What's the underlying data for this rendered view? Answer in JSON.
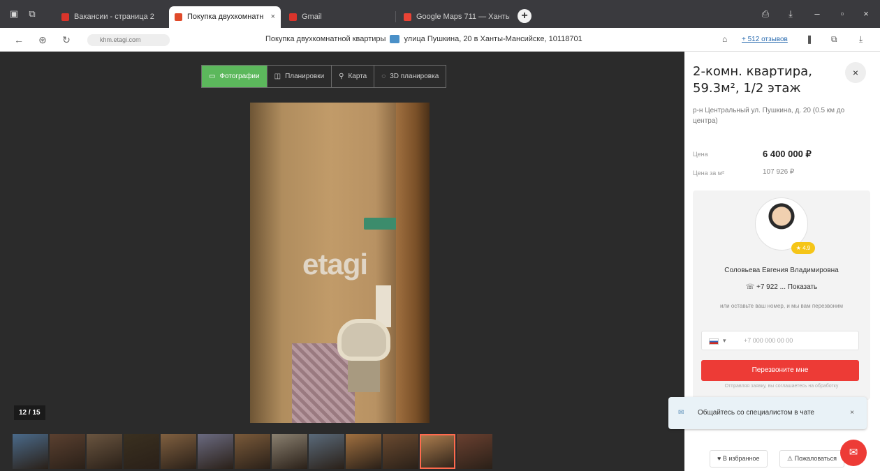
{
  "browser": {
    "tabs": [
      {
        "label": "Вакансии - страница 2",
        "color": "#d9342b"
      },
      {
        "label": "Покупка двухкомнатн",
        "color": "#e04a2a"
      },
      {
        "label": "Gmail",
        "color": "#d9342b"
      },
      {
        "label": "Google Maps 711 — Ханты",
        "color": "#ea4335"
      }
    ],
    "new_tab": "+",
    "close_tab": "×",
    "url": "khm.etagi.com",
    "page_title": "Покупка двухкомнатной квартиры",
    "page_title_address": "улица Пушкина, 20 в Ханты-Мансийске, 10118701",
    "favorites_label": "+ 512 отзывов"
  },
  "viewer": {
    "media_tabs": [
      {
        "icon": "▭",
        "label": "Фотографии",
        "active": true
      },
      {
        "icon": "◫",
        "label": "Планировки",
        "active": false
      },
      {
        "icon": "⚲",
        "label": "Карта",
        "active": false
      },
      {
        "icon": "◌",
        "label": "3D планировка",
        "active": false
      }
    ],
    "watermark": "etagi",
    "counter": "12 / 15",
    "thumbnail_colors": [
      "#4a6a8a",
      "#5a4030",
      "#6a5540",
      "#3a3020",
      "#806040",
      "#6a6a80",
      "#7a5a3a",
      "#8a8070",
      "#5a6a7a",
      "#a07040",
      "#6a4a30",
      "#b08050",
      "#6a4030"
    ],
    "selected_thumbnail": 11
  },
  "listing": {
    "title": "2-комн. квартира, 59.3м², 1/2 этаж",
    "address": "р-н Центральный ул. Пушкина, д. 20 (0.5 км до центра)",
    "price_label": "Цена",
    "price": "6 400 000 ₽",
    "ppm_label": "Цена за м²",
    "ppm": "107 926 ₽"
  },
  "agent": {
    "badge": "★ 4.9",
    "name": "Соловьева Евгения Владимировна",
    "phone": "☏ +7 922 ... Показать",
    "hint": "или оставьте ваш номер, и мы вам перезвоним",
    "phone_placeholder": "+7 000 000 00 00",
    "callback_label": "Перезвоните мне",
    "legal": "Отправляя заявку, вы соглашаетесь на обработку"
  },
  "chat": {
    "popup_text": "Общайтесь со специалистом в чате",
    "close": "×"
  },
  "actions": {
    "favorite": "♥ В избранное",
    "complain": "⚠ Пожаловаться",
    "chat_fab": "✉"
  },
  "colors": {
    "accent_green": "#5cb85c",
    "accent_red": "#ed3b36"
  }
}
